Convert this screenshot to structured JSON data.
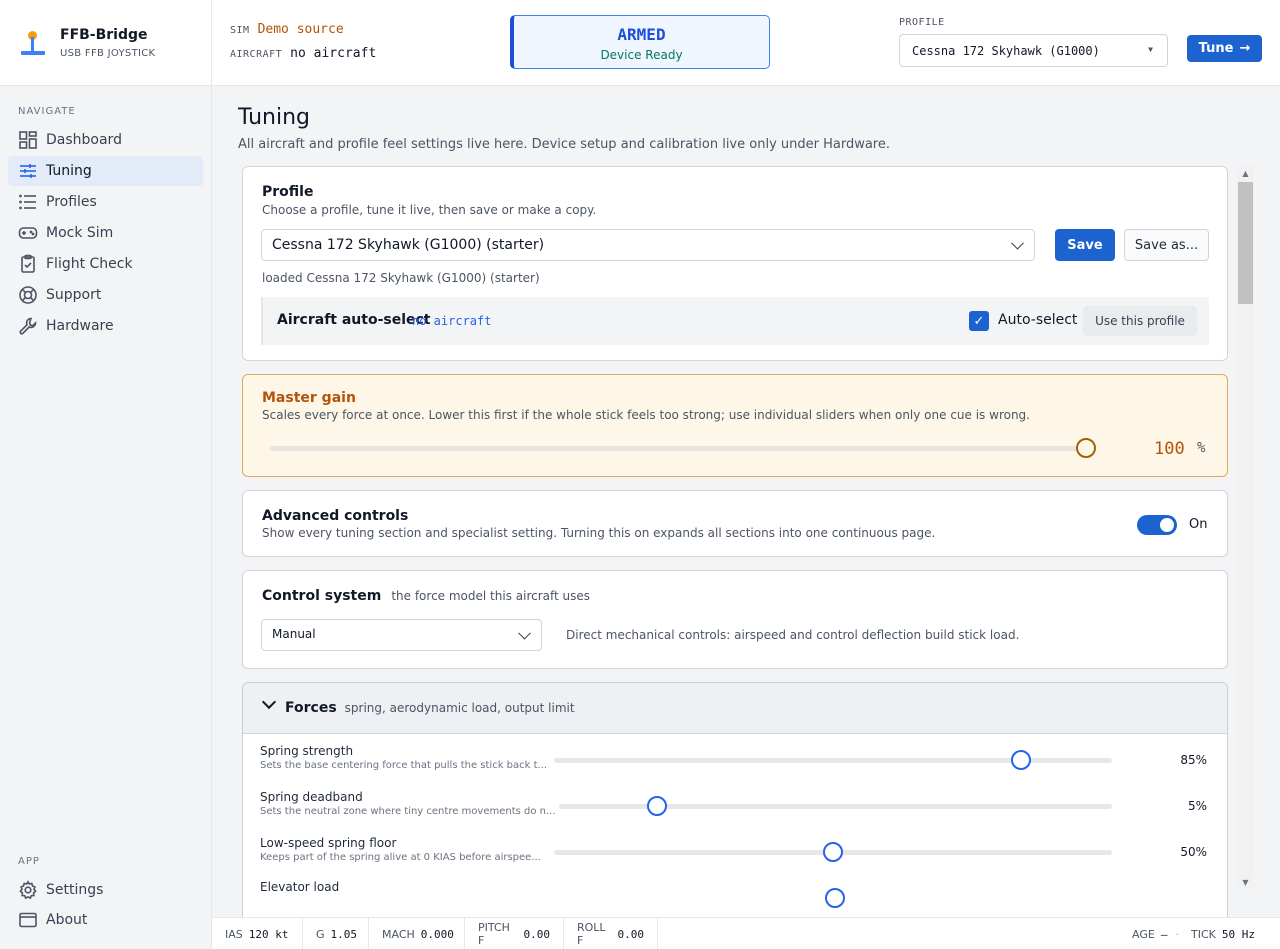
{
  "brand": {
    "name": "FFB-Bridge",
    "subtitle": "USB FFB JOYSTICK"
  },
  "nav": {
    "heading": "NAVIGATE",
    "items": [
      {
        "label": "Dashboard",
        "icon": "dashboard-icon"
      },
      {
        "label": "Tuning",
        "icon": "sliders-icon",
        "active": true
      },
      {
        "label": "Profiles",
        "icon": "list-icon"
      },
      {
        "label": "Mock Sim",
        "icon": "gamepad-icon"
      },
      {
        "label": "Flight Check",
        "icon": "clipboard-check-icon"
      },
      {
        "label": "Support",
        "icon": "lifebuoy-icon"
      },
      {
        "label": "Hardware",
        "icon": "wrench-icon"
      }
    ],
    "app_heading": "APP",
    "app_items": [
      {
        "label": "Settings",
        "icon": "gear-icon"
      },
      {
        "label": "About",
        "icon": "window-icon"
      }
    ]
  },
  "topbar": {
    "sim_label": "SIM",
    "sim_value": "Demo source",
    "aircraft_label": "AIRCRAFT",
    "aircraft_value": "no aircraft",
    "status_title": "ARMED",
    "status_sub": "Device Ready",
    "profile_label": "PROFILE",
    "profile_value": "Cessna 172 Skyhawk (G1000)",
    "tune_label": "Tune"
  },
  "page": {
    "title": "Tuning",
    "subtitle": "All aircraft and profile feel settings live here. Device setup and calibration live only under Hardware."
  },
  "profile_card": {
    "title": "Profile",
    "desc": "Choose a profile, tune it live, then save or make a copy.",
    "selected": "Cessna 172 Skyhawk (G1000) (starter)",
    "save_label": "Save",
    "save_as_label": "Save as...",
    "loaded_text": "loaded Cessna 172 Skyhawk (G1000) (starter)",
    "auto_title": "Aircraft auto-select",
    "auto_value": "no aircraft",
    "auto_checkbox_label": "Auto-select",
    "auto_checked": true,
    "use_profile_label": "Use this profile"
  },
  "master_gain": {
    "title": "Master gain",
    "desc": "Scales every force at once. Lower this first if the whole stick feels too strong; use individual sliders when only one cue is wrong.",
    "value": "100",
    "unit": "%",
    "fraction": 1.0
  },
  "advanced": {
    "title": "Advanced controls",
    "desc": "Show every tuning section and specialist setting. Turning this on expands all sections into one continuous page.",
    "toggle_label": "On",
    "enabled": true
  },
  "control_system": {
    "title": "Control system",
    "hint": "the force model this aircraft uses",
    "selected": "Manual",
    "desc": "Direct mechanical controls: airspeed and control deflection build stick load."
  },
  "forces": {
    "title": "Forces",
    "hint": "spring, aerodynamic load, output limit",
    "rows": [
      {
        "label": "Spring strength",
        "desc": "Sets the base centering force that pulls the stick back t...",
        "value": "85%",
        "fraction": 0.85
      },
      {
        "label": "Spring deadband",
        "desc": "Sets the neutral zone where tiny centre movements do n...",
        "value": "5%",
        "fraction": 0.18
      },
      {
        "label": "Low-speed spring floor",
        "desc": "Keeps part of the spring alive at 0 KIAS before airspee...",
        "value": "50%",
        "fraction": 0.5
      },
      {
        "label": "Elevator load",
        "desc": "",
        "value": "",
        "fraction": 0.5
      }
    ]
  },
  "status": {
    "ias_label": "IAS",
    "ias_value": "120 kt",
    "g_label": "G",
    "g_value": "1.05",
    "mach_label": "MACH",
    "mach_value": "0.000",
    "pitchf_label": "PITCH F",
    "pitchf_value": "0.00",
    "rollf_label": "ROLL F",
    "rollf_value": "0.00",
    "age_label": "AGE",
    "age_value": "—",
    "tick_label": "TICK",
    "tick_value": "50 Hz"
  },
  "colors": {
    "accent": "#1d63d0",
    "gain": "#b45309",
    "ok": "#047857"
  }
}
